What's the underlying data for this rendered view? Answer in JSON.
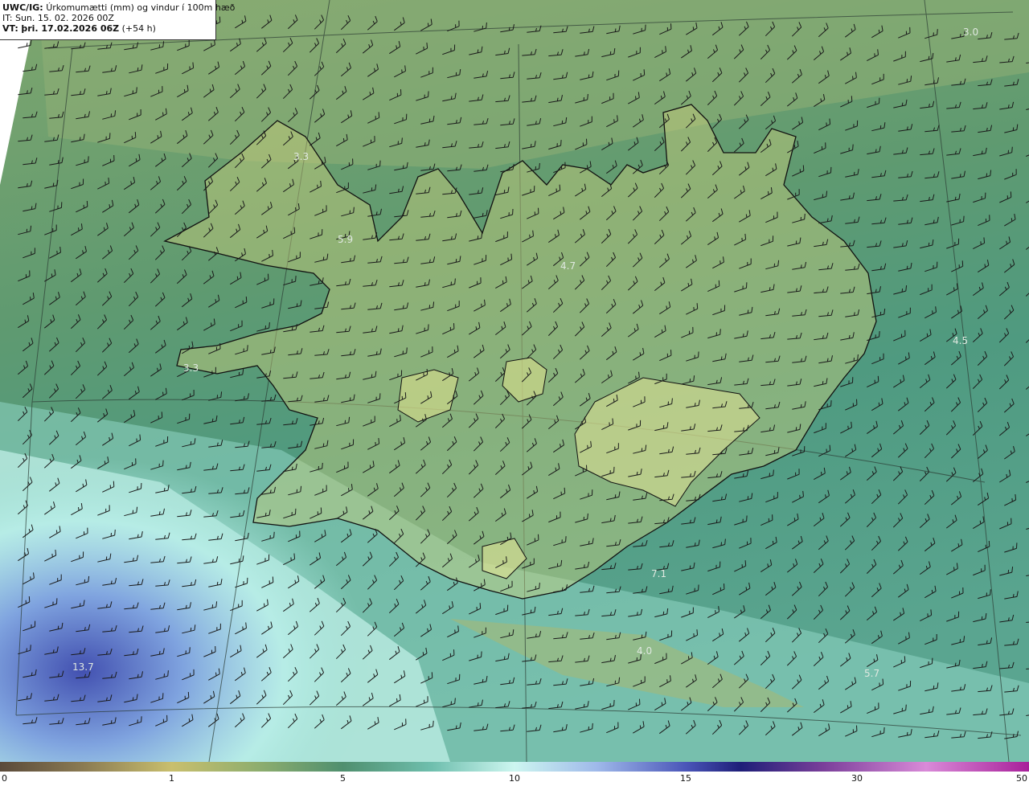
{
  "header": {
    "product": "UWC/IG:",
    "title": "Úrkomumætti (mm) og vindur í 100m hæð",
    "init_label": "IT:",
    "init_time": "Sun. 15. 02. 2026 00Z",
    "valid_label": "VT:",
    "valid_time": "þri. 17.02.2026 06Z",
    "lead_time": "(+54 h)"
  },
  "map_labels": [
    {
      "text": "3.0"
    },
    {
      "text": "3.3"
    },
    {
      "text": "5.9"
    },
    {
      "text": "4.7"
    },
    {
      "text": "3.3"
    },
    {
      "text": "4.5"
    },
    {
      "text": "7.1"
    },
    {
      "text": "4.0"
    },
    {
      "text": "5.7"
    },
    {
      "text": "13.7"
    }
  ],
  "colorbar": {
    "ticks": [
      "0",
      "1",
      "5",
      "10",
      "15",
      "30",
      "50"
    ],
    "colors": {
      "dry": "#5a4a3a",
      "low": "#c9bf6e",
      "mid": "#4f8f6e",
      "high": "#cdf6f0",
      "very_high": "#4a55b8",
      "extreme": "#a8209a"
    }
  }
}
